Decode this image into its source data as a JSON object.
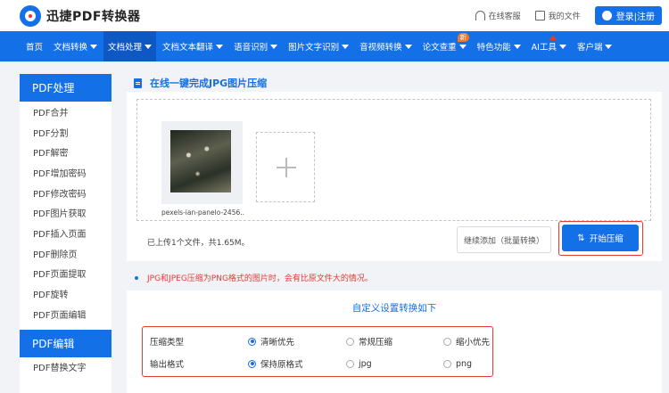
{
  "header": {
    "brand": "迅捷PDF转换器",
    "service_label": "在线客服",
    "files_label": "我的文件",
    "login_label": "登录|注册"
  },
  "nav": {
    "items": [
      {
        "label": "首页",
        "caret": false
      },
      {
        "label": "文档转换",
        "caret": true
      },
      {
        "label": "文档处理",
        "caret": true,
        "active": true
      },
      {
        "label": "文档文本翻译",
        "caret": true
      },
      {
        "label": "语音识别",
        "caret": true
      },
      {
        "label": "图片文字识别",
        "caret": true
      },
      {
        "label": "音视频转换",
        "caret": true
      },
      {
        "label": "论文查重",
        "caret": true,
        "badge": "新"
      },
      {
        "label": "特色功能",
        "caret": true
      },
      {
        "label": "AI工具",
        "caret": true
      },
      {
        "label": "客户端",
        "caret": true
      }
    ]
  },
  "sidebar": {
    "section1_title": "PDF处理",
    "items": [
      "PDF合并",
      "PDF分割",
      "PDF解密",
      "PDF增加密码",
      "PDF修改密码",
      "PDF图片获取",
      "PDF插入页面",
      "PDF删除页",
      "PDF页面提取",
      "PDF旋转",
      "PDF页面编辑"
    ],
    "section2_title": "PDF编辑",
    "section2_items": [
      "PDF替换文字"
    ]
  },
  "main": {
    "title": "在线一键完成JPG图片压缩",
    "file_name": "pexels-ian-panelo-2456...",
    "uploaded_info": "已上传1个文件，共1.65M。",
    "continue_label": "继续添加（批量转换）",
    "start_label": "开始压缩",
    "note": "JPG和JPEG压缩为PNG格式的图片时，会有比原文件大的情况。"
  },
  "settings": {
    "title": "自定义设置转换如下",
    "compress_type_label": "压缩类型",
    "compress_options": [
      "清晰优先",
      "常规压缩",
      "缩小优先"
    ],
    "compress_selected": "清晰优先",
    "format_label": "输出格式",
    "format_options": [
      "保持原格式",
      "jpg",
      "png"
    ],
    "format_selected": "保持原格式"
  },
  "colors": {
    "brand_blue": "#1470e6",
    "highlight_red": "#e23b32"
  }
}
